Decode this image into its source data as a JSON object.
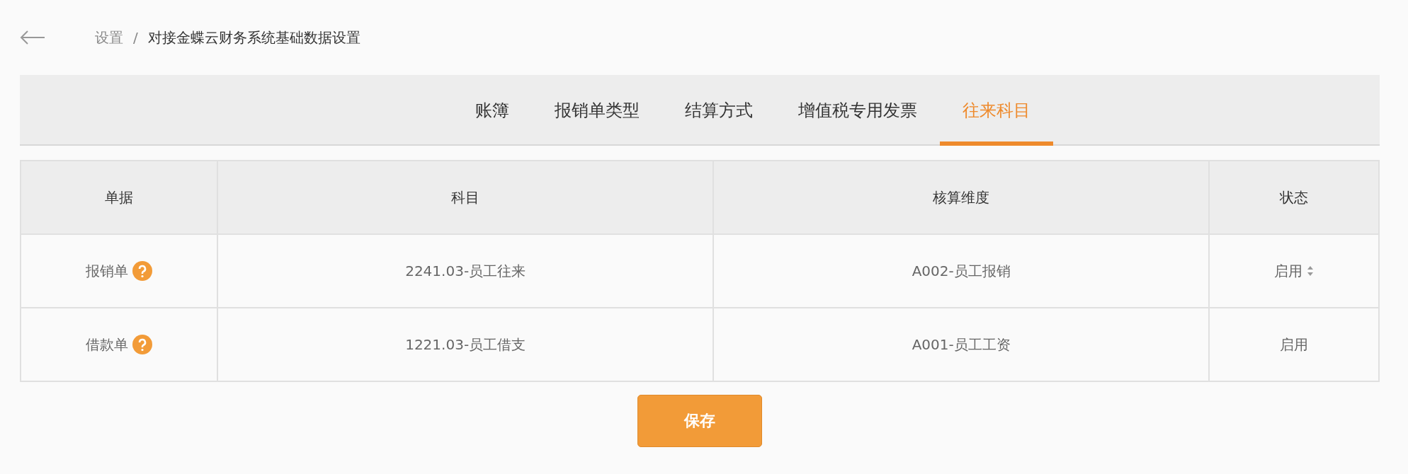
{
  "breadcrumb": {
    "parent": "设置",
    "separator": "/",
    "current": "对接金蝶云财务系统基础数据设置"
  },
  "tabs": [
    {
      "label": "账簿",
      "selected": false
    },
    {
      "label": "报销单类型",
      "selected": false
    },
    {
      "label": "结算方式",
      "selected": false
    },
    {
      "label": "增值税专用发票",
      "selected": false
    },
    {
      "label": "往来科目",
      "selected": true
    }
  ],
  "table": {
    "columns": [
      "单据",
      "科目",
      "核算维度",
      "状态"
    ],
    "rows": [
      {
        "document": "报销单",
        "account": "2241.03-员工往来",
        "dimension": "A002-员工报销",
        "status": {
          "kind": "select",
          "value": "启用"
        }
      },
      {
        "document": "借款单",
        "account": "1221.03-员工借支",
        "dimension": "A001-员工工资",
        "status": {
          "kind": "text",
          "value": "启用"
        }
      }
    ]
  },
  "save_button": "保存"
}
